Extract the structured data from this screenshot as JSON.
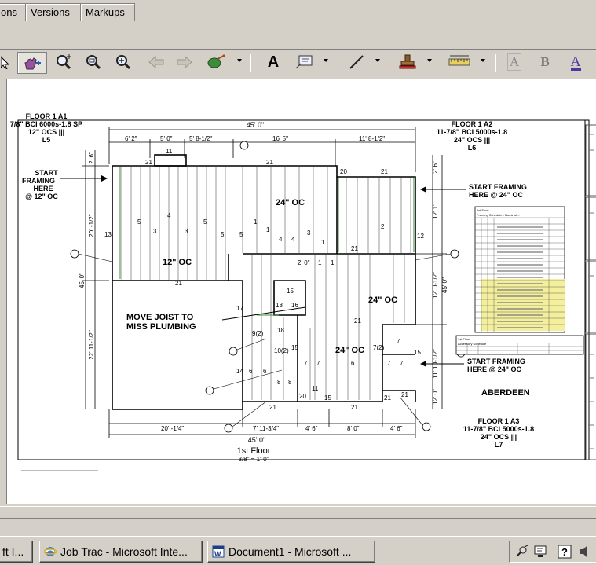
{
  "tabs": [
    "ons",
    "Versions",
    "Markups"
  ],
  "toolbar": {
    "icons": [
      "select-arrow-icon",
      "pan-hand-icon",
      "zoom-window-icon",
      "zoom-icon",
      "zoom-in-icon",
      "back-arrow-icon",
      "forward-arrow-icon",
      "link-icon",
      "text-tool-icon",
      "callout-tool-icon",
      "line-tool-icon",
      "stamp-tool-icon",
      "measure-tool-icon",
      "text-style-icon",
      "bold-icon",
      "font-color-icon"
    ],
    "text_tool": "A",
    "text_style": "A",
    "bold": "B",
    "font_color": "A"
  },
  "drawing": {
    "floor1_a1": [
      "FLOOR 1 A1",
      "7/8\" BCI 6000s-1.8 SP",
      "12\" OCS |||",
      "L5"
    ],
    "floor1_a2": [
      "FLOOR 1 A2",
      "11-7/8\" BCI 5000s-1.8",
      "24\" OCS |||",
      "L6"
    ],
    "floor1_a3": [
      "FLOOR 1 A3",
      "11-7/8\" BCI 5000s-1.8",
      "24\" OCS |||",
      "L7"
    ],
    "start_framing_12": [
      "START",
      "FRAMING",
      "HERE",
      "@ 12\" OC"
    ],
    "start_framing_24a": [
      "START FRAMING",
      "HERE @ 24\" OC"
    ],
    "start_framing_24b": [
      "START FRAMING",
      "HERE @ 24\" OC"
    ],
    "move_joist": [
      "MOVE JOIST TO",
      "MISS PLUMBING"
    ],
    "spacing_24_main": "24\" OC",
    "spacing_12": "12\" OC",
    "spacing_24_right": "24\" OC",
    "spacing_24_lower": "24\" OC",
    "project_name": "ABERDEEN",
    "floor_title": "1st Floor",
    "scale": "3/8\" = 1'-0\"",
    "dim_top_total": "45' 0\"",
    "dim_bottom_total": "45' 0\"",
    "dims_top": [
      "6' 2\"",
      "5' 0\"",
      "5' 8-1/2\"",
      "16' 5\"",
      "11' 8-1/2\""
    ],
    "dims_bottom": [
      "20' -1/4\"",
      "7' 11-3/4\"",
      "4' 6\"",
      "8' 0\"",
      "4' 6\""
    ],
    "dims_left": [
      "2' 6\"",
      "20' -1/2\"",
      "45' 0\"",
      "22' 11-1/2\""
    ],
    "dims_right": [
      "2' 6\"",
      "12' 1\"",
      "12' 0-1/2\"",
      "45' 0\"",
      "11' 10-1/2\"",
      "12' 0\""
    ],
    "labels": [
      "21",
      "11",
      "21",
      "20",
      "21",
      "13",
      "5",
      "4",
      "5",
      "3",
      "3",
      "5",
      "5",
      "1",
      "1",
      "4",
      "4",
      "3",
      "1",
      "2",
      "12",
      "21",
      "21",
      "2' 0\"",
      "1",
      "1",
      "17",
      "18",
      "16",
      "15",
      "9(2)",
      "18",
      "10(2)",
      "15",
      "7(2)",
      "21",
      "14",
      "6",
      "6",
      "8",
      "8",
      "7",
      "7",
      "6",
      "7",
      "7",
      "15",
      "20",
      "15",
      "21",
      "21",
      "21",
      "21",
      "11",
      "7"
    ],
    "schedule_title": [
      "1st Floor",
      "Framing Schedule - Nominal ..."
    ],
    "schedule_notes": [
      "1st Floor",
      "Accessory Schedule"
    ]
  },
  "taskbar": {
    "items": [
      "ft I...",
      "Job Trac - Microsoft Inte...",
      "Document1 - Microsoft ..."
    ]
  }
}
